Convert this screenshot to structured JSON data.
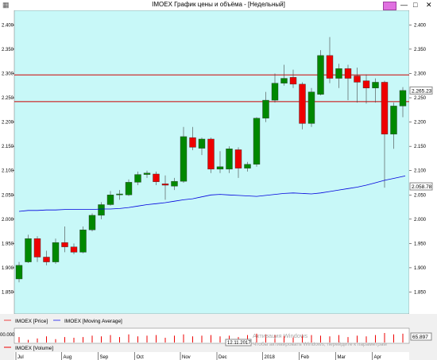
{
  "window": {
    "title": "IMOEX График цены и объёма - [Недельный]",
    "minimize": "—",
    "maximize": "□",
    "close": "✕",
    "colors": {
      "pin": "#e070e0"
    }
  },
  "chart_data": {
    "type": "candlestick",
    "colors": {
      "background": "#c8f8f8",
      "up": "#008800",
      "down": "#ee0000",
      "ma": "#0000dd",
      "hline": "#cc0000"
    },
    "y_ticks": [
      1850,
      1900,
      1950,
      2000,
      2050,
      2100,
      2150,
      2200,
      2250,
      2300,
      2350,
      2400
    ],
    "y_labels": [
      "1.850",
      "1.900",
      "1.950",
      "2.000",
      "2.050",
      "2.100",
      "2.150",
      "2.200",
      "2.250",
      "2.300",
      "2.350",
      "2.400"
    ],
    "ylim": [
      1805,
      2430
    ],
    "x_labels": [
      {
        "label": "Jul",
        "index": 0
      },
      {
        "label": "Aug",
        "index": 5
      },
      {
        "label": "Sep",
        "index": 9
      },
      {
        "label": "Oct",
        "index": 13
      },
      {
        "label": "Nov",
        "index": 18
      },
      {
        "label": "Dec",
        "index": 22
      },
      {
        "label": "2018",
        "index": 27
      },
      {
        "label": "Feb",
        "index": 31
      },
      {
        "label": "Mar",
        "index": 35
      },
      {
        "label": "Apr",
        "index": 39
      }
    ],
    "candles": [
      {
        "o": 1877,
        "h": 1912,
        "l": 1870,
        "c": 1905
      },
      {
        "o": 1912,
        "h": 1968,
        "l": 1910,
        "c": 1960
      },
      {
        "o": 1960,
        "h": 1965,
        "l": 1912,
        "c": 1922
      },
      {
        "o": 1922,
        "h": 1935,
        "l": 1905,
        "c": 1912
      },
      {
        "o": 1912,
        "h": 1960,
        "l": 1908,
        "c": 1952
      },
      {
        "o": 1952,
        "h": 1985,
        "l": 1932,
        "c": 1943
      },
      {
        "o": 1943,
        "h": 1950,
        "l": 1928,
        "c": 1932
      },
      {
        "o": 1932,
        "h": 1985,
        "l": 1930,
        "c": 1978
      },
      {
        "o": 1978,
        "h": 2012,
        "l": 1975,
        "c": 2008
      },
      {
        "o": 2008,
        "h": 2035,
        "l": 2000,
        "c": 2030
      },
      {
        "o": 2030,
        "h": 2058,
        "l": 2028,
        "c": 2050
      },
      {
        "o": 2050,
        "h": 2060,
        "l": 2040,
        "c": 2052
      },
      {
        "o": 2050,
        "h": 2082,
        "l": 2048,
        "c": 2076
      },
      {
        "o": 2076,
        "h": 2098,
        "l": 2070,
        "c": 2092
      },
      {
        "o": 2092,
        "h": 2100,
        "l": 2085,
        "c": 2095
      },
      {
        "o": 2093,
        "h": 2098,
        "l": 2070,
        "c": 2077
      },
      {
        "o": 2073,
        "h": 2090,
        "l": 2040,
        "c": 2070
      },
      {
        "o": 2068,
        "h": 2085,
        "l": 2060,
        "c": 2078
      },
      {
        "o": 2078,
        "h": 2190,
        "l": 2075,
        "c": 2170
      },
      {
        "o": 2168,
        "h": 2190,
        "l": 2142,
        "c": 2148
      },
      {
        "o": 2146,
        "h": 2168,
        "l": 2132,
        "c": 2165
      },
      {
        "o": 2165,
        "h": 2168,
        "l": 2095,
        "c": 2103
      },
      {
        "o": 2103,
        "h": 2140,
        "l": 2095,
        "c": 2108
      },
      {
        "o": 2103,
        "h": 2150,
        "l": 2095,
        "c": 2145
      },
      {
        "o": 2143,
        "h": 2148,
        "l": 2085,
        "c": 2105
      },
      {
        "o": 2105,
        "h": 2118,
        "l": 2098,
        "c": 2113
      },
      {
        "o": 2113,
        "h": 2210,
        "l": 2108,
        "c": 2208
      },
      {
        "o": 2208,
        "h": 2262,
        "l": 2200,
        "c": 2245
      },
      {
        "o": 2245,
        "h": 2300,
        "l": 2240,
        "c": 2280
      },
      {
        "o": 2280,
        "h": 2318,
        "l": 2275,
        "c": 2290
      },
      {
        "o": 2292,
        "h": 2308,
        "l": 2270,
        "c": 2278
      },
      {
        "o": 2278,
        "h": 2282,
        "l": 2185,
        "c": 2197
      },
      {
        "o": 2197,
        "h": 2270,
        "l": 2190,
        "c": 2262
      },
      {
        "o": 2257,
        "h": 2348,
        "l": 2255,
        "c": 2337
      },
      {
        "o": 2337,
        "h": 2375,
        "l": 2280,
        "c": 2290
      },
      {
        "o": 2290,
        "h": 2320,
        "l": 2270,
        "c": 2310
      },
      {
        "o": 2310,
        "h": 2318,
        "l": 2245,
        "c": 2290
      },
      {
        "o": 2295,
        "h": 2312,
        "l": 2240,
        "c": 2282
      },
      {
        "o": 2285,
        "h": 2298,
        "l": 2238,
        "c": 2270
      },
      {
        "o": 2270,
        "h": 2290,
        "l": 2240,
        "c": 2282
      },
      {
        "o": 2282,
        "h": 2285,
        "l": 2065,
        "c": 2175
      },
      {
        "o": 2175,
        "h": 2240,
        "l": 2145,
        "c": 2233
      },
      {
        "o": 2233,
        "h": 2272,
        "l": 2210,
        "c": 2265
      }
    ],
    "moving_average": [
      2016,
      2018,
      2018,
      2019,
      2019,
      2020,
      2020,
      2020,
      2020,
      2021,
      2021,
      2022,
      2024,
      2027,
      2030,
      2032,
      2034,
      2037,
      2040,
      2042,
      2046,
      2050,
      2051,
      2050,
      2049,
      2048,
      2047,
      2049,
      2051,
      2053,
      2054,
      2053,
      2052,
      2054,
      2057,
      2060,
      2063,
      2066,
      2070,
      2075,
      2080,
      2084,
      2088
    ],
    "h_lines": [
      2297,
      2242
    ],
    "price_label": "2.265.23",
    "ma_label": "2.058.78",
    "legend": [
      {
        "label": "IMOEX [Price]",
        "color": "#ee4444"
      },
      {
        "label": "IMOEX [Moving Average]",
        "color": "#4444ee"
      }
    ],
    "volume": {
      "label": "IMOEX [Volume]",
      "color": "#ee0000",
      "axis_label": "00.000",
      "last_value": "65.897",
      "cursor_date": "12.11.2017",
      "values": [
        40,
        20,
        30,
        45,
        25,
        40,
        35,
        40,
        50,
        45,
        55,
        40,
        60,
        45,
        50,
        55,
        35,
        50,
        60,
        45,
        50,
        55,
        45,
        50,
        40,
        55,
        65,
        60,
        55,
        50,
        45,
        60,
        55,
        50,
        45,
        55,
        40,
        50,
        45,
        55,
        70,
        60,
        65
      ]
    }
  },
  "watermark": {
    "line1": "Активация Windows",
    "line2": "Чтобы активировать Windows, перейдите к параметрам"
  }
}
